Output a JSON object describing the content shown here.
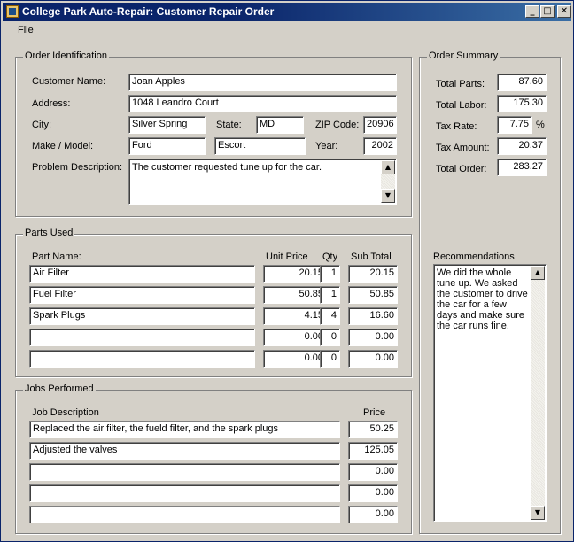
{
  "window": {
    "title": "College Park Auto-Repair: Customer Repair Order",
    "minimize": "0",
    "maximize": "1",
    "close": "r"
  },
  "menu": {
    "file": "File"
  },
  "order": {
    "legend": "Order Identification",
    "customer_name_label": "Customer Name:",
    "customer_name": "Joan Apples",
    "address_label": "Address:",
    "address": "1048 Leandro Court",
    "city_label": "City:",
    "city": "Silver Spring",
    "state_label": "State:",
    "state": "MD",
    "zip_label": "ZIP Code:",
    "zip": "20906",
    "make_model_label": "Make / Model:",
    "make": "Ford",
    "model": "Escort",
    "year_label": "Year:",
    "year": "2002",
    "problem_label": "Problem Description:",
    "problem": "The customer requested tune up for the car."
  },
  "parts": {
    "legend": "Parts Used",
    "headers": {
      "name": "Part Name:",
      "unit_price": "Unit Price",
      "qty": "Qty",
      "sub_total": "Sub Total"
    },
    "rows": [
      {
        "name": "Air Filter",
        "unit_price": "20.15",
        "qty": "1",
        "sub_total": "20.15"
      },
      {
        "name": "Fuel Filter",
        "unit_price": "50.85",
        "qty": "1",
        "sub_total": "50.85"
      },
      {
        "name": "Spark Plugs",
        "unit_price": "4.15",
        "qty": "4",
        "sub_total": "16.60"
      },
      {
        "name": "",
        "unit_price": "0.00",
        "qty": "0",
        "sub_total": "0.00"
      },
      {
        "name": "",
        "unit_price": "0.00",
        "qty": "0",
        "sub_total": "0.00"
      }
    ]
  },
  "jobs": {
    "legend": "Jobs Performed",
    "headers": {
      "description": "Job Description",
      "price": "Price"
    },
    "rows": [
      {
        "description": "Replaced the air filter, the fueld filter, and the spark plugs",
        "price": "50.25"
      },
      {
        "description": "Adjusted the valves",
        "price": "125.05"
      },
      {
        "description": "",
        "price": "0.00"
      },
      {
        "description": "",
        "price": "0.00"
      },
      {
        "description": "",
        "price": "0.00"
      }
    ]
  },
  "summary": {
    "legend": "Order Summary",
    "total_parts_label": "Total Parts:",
    "total_parts": "87.60",
    "total_labor_label": "Total Labor:",
    "total_labor": "175.30",
    "tax_rate_label": "Tax Rate:",
    "tax_rate": "7.75",
    "percent": "%",
    "tax_amount_label": "Tax Amount:",
    "tax_amount": "20.37",
    "total_order_label": "Total Order:",
    "total_order": "283.27",
    "recommendations_label": "Recommendations",
    "recommendations": "We did the whole tune up. We asked the customer to drive the car for a few days and make sure the car runs fine."
  }
}
